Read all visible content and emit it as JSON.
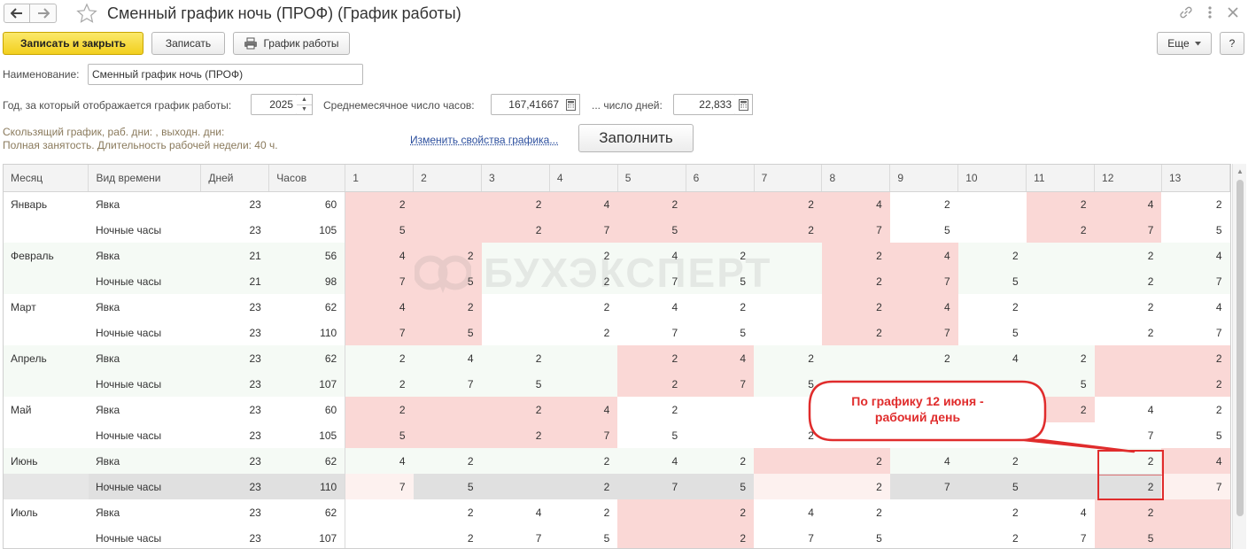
{
  "window": {
    "title": "Сменный график ночь (ПРОФ) (График работы)"
  },
  "toolbar": {
    "save_close": "Записать и закрыть",
    "save": "Записать",
    "schedule": "График работы",
    "more": "Еще",
    "help": "?"
  },
  "form": {
    "name_label": "Наименование:",
    "name_value": "Сменный график ночь (ПРОФ)",
    "year_label": "Год, за который отображается график работы:",
    "year_value": "2025",
    "avg_hours_label": "Среднемесячное число часов:",
    "avg_hours_value": "167,41667",
    "days_label": "... число дней:",
    "days_value": "22,833",
    "note_line1": "Скользящий график, раб. дни: , выходн. дни:",
    "note_line2": "Полная занятость. Длительность рабочей недели: 40 ч.",
    "change_link": "Изменить свойства графика...",
    "fill_button": "Заполнить"
  },
  "grid": {
    "headers": [
      "Месяц",
      "Вид времени",
      "Дней",
      "Часов",
      "1",
      "2",
      "3",
      "4",
      "5",
      "6",
      "7",
      "8",
      "9",
      "10",
      "11",
      "12",
      "13"
    ],
    "rows": [
      {
        "month": "Январь",
        "kind": "Явка",
        "days": "23",
        "hours": "60",
        "cells": [
          "2",
          "",
          "2",
          "4",
          "2",
          "",
          "2",
          "4",
          "2",
          "",
          "2",
          "4",
          "2"
        ],
        "bg": "w"
      },
      {
        "month": "",
        "kind": "Ночные часы",
        "days": "23",
        "hours": "105",
        "cells": [
          "5",
          "",
          "2",
          "7",
          "5",
          "",
          "2",
          "7",
          "5",
          "",
          "2",
          "7",
          "5"
        ],
        "bg": "w"
      },
      {
        "month": "Февраль",
        "kind": "Явка",
        "days": "21",
        "hours": "56",
        "cells": [
          "4",
          "2",
          "",
          "2",
          "4",
          "2",
          "",
          "2",
          "4",
          "2",
          "",
          "2",
          "4"
        ],
        "bg": "g"
      },
      {
        "month": "",
        "kind": "Ночные часы",
        "days": "21",
        "hours": "98",
        "cells": [
          "7",
          "5",
          "",
          "2",
          "7",
          "5",
          "",
          "2",
          "7",
          "5",
          "",
          "2",
          "7"
        ],
        "bg": "g"
      },
      {
        "month": "Март",
        "kind": "Явка",
        "days": "23",
        "hours": "62",
        "cells": [
          "4",
          "2",
          "",
          "2",
          "4",
          "2",
          "",
          "2",
          "4",
          "2",
          "",
          "2",
          "4"
        ],
        "bg": "w"
      },
      {
        "month": "",
        "kind": "Ночные часы",
        "days": "23",
        "hours": "110",
        "cells": [
          "7",
          "5",
          "",
          "2",
          "7",
          "5",
          "",
          "2",
          "7",
          "5",
          "",
          "2",
          "7"
        ],
        "bg": "w"
      },
      {
        "month": "Апрель",
        "kind": "Явка",
        "days": "23",
        "hours": "62",
        "cells": [
          "2",
          "4",
          "2",
          "",
          "2",
          "4",
          "2",
          "",
          "2",
          "4",
          "2",
          "",
          "2"
        ],
        "bg": "g"
      },
      {
        "month": "",
        "kind": "Ночные часы",
        "days": "23",
        "hours": "107",
        "cells": [
          "2",
          "7",
          "5",
          "",
          "2",
          "7",
          "5",
          "",
          "",
          "",
          "5",
          "",
          "2"
        ],
        "bg": "g"
      },
      {
        "month": "Май",
        "kind": "Явка",
        "days": "23",
        "hours": "60",
        "cells": [
          "2",
          "",
          "2",
          "4",
          "2",
          "",
          "",
          "",
          "",
          "",
          "2",
          "4",
          "2"
        ],
        "bg": "w"
      },
      {
        "month": "",
        "kind": "Ночные часы",
        "days": "23",
        "hours": "105",
        "cells": [
          "5",
          "",
          "2",
          "7",
          "5",
          "",
          "2",
          "",
          "",
          "",
          "",
          "7",
          "5"
        ],
        "bg": "w"
      },
      {
        "month": "Июнь",
        "kind": "Явка",
        "days": "23",
        "hours": "62",
        "cells": [
          "4",
          "2",
          "",
          "2",
          "4",
          "2",
          "",
          "2",
          "4",
          "2",
          "",
          "2",
          "4"
        ],
        "bg": "g"
      },
      {
        "month": "",
        "kind": "Ночные часы",
        "days": "23",
        "hours": "110",
        "cells": [
          "7",
          "5",
          "",
          "2",
          "7",
          "5",
          "",
          "2",
          "7",
          "5",
          "",
          "2",
          "7"
        ],
        "bg": "sel"
      },
      {
        "month": "Июль",
        "kind": "Явка",
        "days": "23",
        "hours": "62",
        "cells": [
          "",
          "2",
          "4",
          "2",
          "",
          "2",
          "4",
          "2",
          "",
          "2",
          "4",
          "2",
          ""
        ],
        "bg": "w"
      },
      {
        "month": "",
        "kind": "Ночные часы",
        "days": "23",
        "hours": "107",
        "cells": [
          "",
          "2",
          "7",
          "5",
          "",
          "2",
          "7",
          "5",
          "",
          "2",
          "7",
          "5",
          ""
        ],
        "bg": "w"
      }
    ]
  },
  "annotation": {
    "callout": "По графику 12 июня - рабочий день",
    "color": "#e02c2c"
  },
  "watermark": {
    "text": "БУХЭКСПЕРТ"
  },
  "colors": {
    "primary_button": "#f2cf1e",
    "day_off": "#fad8d6",
    "link": "#2c4f9e"
  }
}
